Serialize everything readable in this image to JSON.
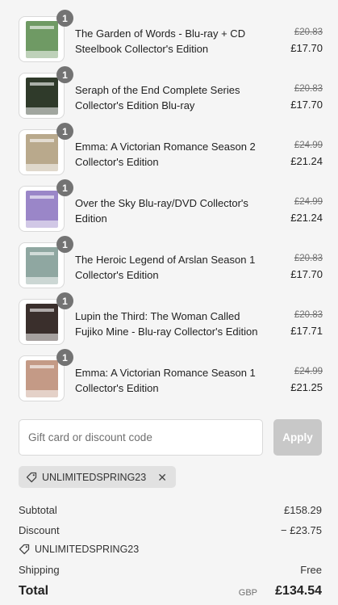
{
  "cart_items": [
    {
      "title_line1": "The Garden of Words - Blu-ray + CD",
      "title_line2": "Steelbook Collector's Edition",
      "original_price": "£20.83",
      "price": "£17.70",
      "quantity": "1",
      "thumb_color": "#6f9a64"
    },
    {
      "title_line1": "Seraph of the End Complete Series",
      "title_line2": "Collector's Edition Blu-ray",
      "original_price": "£20.83",
      "price": "£17.70",
      "quantity": "1",
      "thumb_color": "#2f3a2a"
    },
    {
      "title_line1": "Emma: A Victorian Romance Season 2",
      "title_line2": "Collector's Edition",
      "original_price": "£24.99",
      "price": "£21.24",
      "quantity": "1",
      "thumb_color": "#b9a98c"
    },
    {
      "title_line1": "Over the Sky Blu-ray/DVD Collector's",
      "title_line2": "Edition",
      "original_price": "£24.99",
      "price": "£21.24",
      "quantity": "1",
      "thumb_color": "#9a86c8"
    },
    {
      "title_line1": "The Heroic Legend of Arslan Season 1",
      "title_line2": "Collector's Edition",
      "original_price": "£20.83",
      "price": "£17.70",
      "quantity": "1",
      "thumb_color": "#8fa7a1"
    },
    {
      "title_line1": "Lupin the Third: The Woman Called",
      "title_line2": "Fujiko Mine - Blu-ray Collector's Edition",
      "original_price": "£20.83",
      "price": "£17.71",
      "quantity": "1",
      "thumb_color": "#3a2f2c"
    },
    {
      "title_line1": "Emma: A Victorian Romance Season 1",
      "title_line2": "Collector's Edition",
      "original_price": "£24.99",
      "price": "£21.25",
      "quantity": "1",
      "thumb_color": "#c49a86"
    }
  ],
  "discount": {
    "placeholder": "Gift card or discount code",
    "apply_label": "Apply",
    "applied_tag": "UNLIMITEDSPRING23",
    "remove_symbol": "✕"
  },
  "summary": {
    "subtotal_label": "Subtotal",
    "subtotal_value": "£158.29",
    "discount_label": "Discount",
    "discount_value": "− £23.75",
    "discount_code": "UNLIMITEDSPRING23",
    "shipping_label": "Shipping",
    "shipping_value": "Free",
    "total_label": "Total",
    "currency": "GBP",
    "total_value": "£134.54"
  },
  "icons": {
    "tag": "tag-icon",
    "remove": "close-icon"
  }
}
